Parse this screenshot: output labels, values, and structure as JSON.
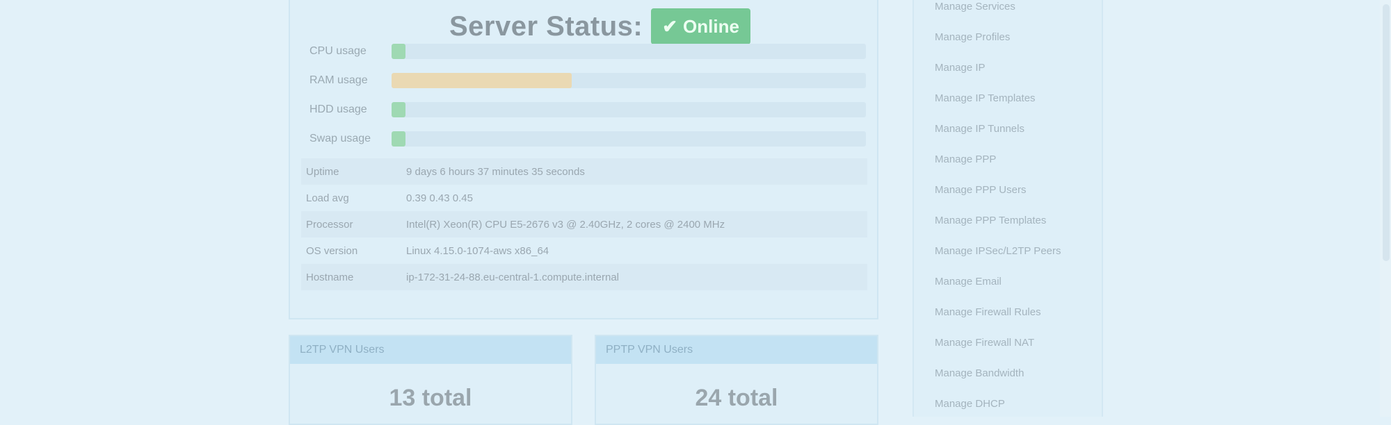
{
  "server_status": {
    "title": "Server Status:",
    "badge": "Online",
    "badge_icon": "check-icon",
    "accent_color": "#76c895"
  },
  "usage": [
    {
      "label": "CPU usage",
      "percent": 3,
      "color": "#9fd9b3"
    },
    {
      "label": "RAM usage",
      "percent": 38,
      "color": "#ead9b3"
    },
    {
      "label": "HDD usage",
      "percent": 3,
      "color": "#9fd9b3"
    },
    {
      "label": "Swap usage",
      "percent": 3,
      "color": "#9fd9b3"
    }
  ],
  "info": [
    {
      "key": "Uptime",
      "value": "9 days 6 hours 37 minutes 35 seconds"
    },
    {
      "key": "Load avg",
      "value": "0.39 0.43 0.45"
    },
    {
      "key": "Processor",
      "value": "Intel(R) Xeon(R) CPU E5-2676 v3 @ 2.40GHz, 2 cores @ 2400 MHz"
    },
    {
      "key": "OS version",
      "value": "Linux 4.15.0-1074-aws x86_64"
    },
    {
      "key": "Hostname",
      "value": "ip-172-31-24-88.eu-central-1.compute.internal"
    }
  ],
  "stats": [
    {
      "head": "L2TP VPN Users",
      "total": "13 total"
    },
    {
      "head": "PPTP VPN Users",
      "total": "24 total"
    }
  ],
  "sidebar": {
    "items": [
      "Manage Services",
      "Manage Profiles",
      "Manage IP",
      "Manage IP Templates",
      "Manage IP Tunnels",
      "Manage PPP",
      "Manage PPP Users",
      "Manage PPP Templates",
      "Manage IPSec/L2TP Peers",
      "Manage Email",
      "Manage Firewall Rules",
      "Manage Firewall NAT",
      "Manage Bandwidth",
      "Manage DHCP"
    ]
  }
}
